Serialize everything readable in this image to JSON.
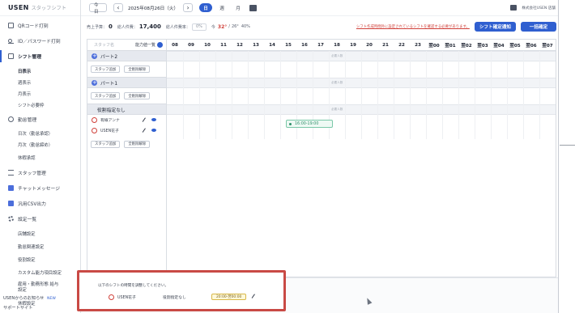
{
  "sidebar": {
    "brand_main": "USEN",
    "brand_sub": "スタッフシフト",
    "items": [
      {
        "label": "QRコード打刻",
        "icon": "qr-code-icon"
      },
      {
        "label": "ID／パスワード打刻",
        "icon": "key-icon"
      },
      {
        "label": "シフト管理",
        "icon": "calendar-icon"
      }
    ],
    "shift_sub": [
      "日表示",
      "週表示",
      "月表示",
      "シフト必要枠"
    ],
    "attendance_label": "勤怠管理",
    "attendance_sub": [
      "日次（勤怠承認）",
      "月次（勤怠締め）",
      "休暇承認"
    ],
    "staff_label": "スタッフ管理",
    "chat_label": "チャットメッセージ",
    "csv_label": "汎用CSV出力",
    "settings_label": "設定一覧",
    "settings_sub": [
      "店舗設定",
      "勤怠関連設定",
      "役割設定",
      "カスタム能力項目設定",
      "雇用・勤務形態 給与設定",
      "休暇設定"
    ],
    "news_label": "USENからのお知らせ",
    "news_tag": "NEW",
    "support_label": "サポートサイト"
  },
  "topbar": {
    "today_label": "今日",
    "date_label": "2025年08月26日（火）",
    "prev_icon": "chevron-left-icon",
    "next_icon": "chevron-right-icon",
    "view_day": "日",
    "view_week": "週",
    "view_month": "月",
    "calendar_icon": "calendar-icon",
    "chat_icon": "chat-icon",
    "user_label": "株式会社USEN 店舗"
  },
  "stats": {
    "sales_label": "売上予算：",
    "sales_value": "0",
    "labor_label": "総人件費：",
    "labor_value": "17,400",
    "ratio_label": "総人件費率：",
    "ratio_value": "0%",
    "weather_label": "今",
    "temp_high": "32°",
    "temp_low": "26°",
    "precip": "40%",
    "warning_text": "シフト作成時間外に設定されているシフトを確認する必要があります。",
    "notify_button": "シフト確定通知",
    "confirm_button": "一括確定"
  },
  "grid": {
    "search_placeholder": "スタッフ名",
    "filter_label": "能力値一覧",
    "hours": [
      "08",
      "09",
      "10",
      "11",
      "12",
      "13",
      "14",
      "15",
      "16",
      "17",
      "18",
      "19",
      "20",
      "21",
      "22",
      "23",
      "翌00",
      "翌01",
      "翌02",
      "翌03",
      "翌04",
      "翌05",
      "翌06",
      "翌07"
    ],
    "need_label": "必要人数",
    "groups": [
      {
        "title": "パート2",
        "add_staff": "スタッフ追加",
        "bulk_delete": "全削除解除"
      },
      {
        "title": "パート1",
        "add_staff": "スタッフ追加",
        "bulk_delete": "全削除解除"
      }
    ],
    "no_role_title": "役割指定なし",
    "staff": [
      {
        "name": "有線アンナ"
      },
      {
        "name": "USEN花子"
      }
    ],
    "no_role_add": "スタッフ追加",
    "no_role_delete": "全削除解除",
    "shift_time": "16:00-19:00"
  },
  "warning_panel": {
    "message": "以下のシフトの時間を調整してください。",
    "staff_name": "USEN花子",
    "role": "役割指定なし",
    "time": "20:00-翌00:00"
  }
}
